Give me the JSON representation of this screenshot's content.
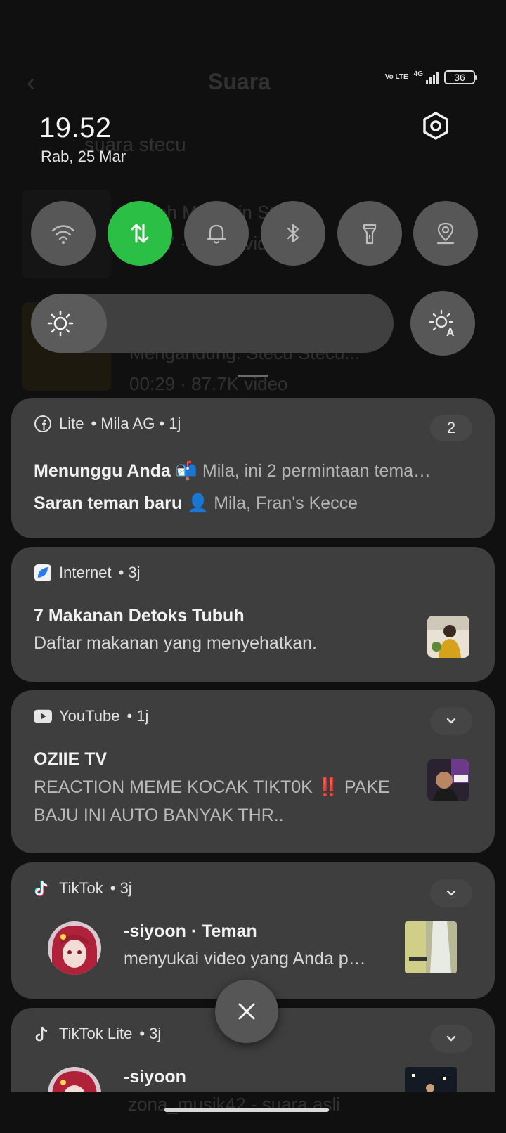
{
  "background_app": {
    "title": "Suara",
    "search": "suara stecu",
    "row1_line1": "Ikweh Meringin Stecu",
    "row1_line2": "00:17 · 14.2K video",
    "row2_line1": "Mengandung: Stecu Stecu...",
    "row2_line2": "00:29 · 87.7K video",
    "bottom_text": "zona_musik42 - suara asli"
  },
  "status_bar": {
    "volte": "Vo LTE",
    "network": "4G",
    "battery": "36"
  },
  "header": {
    "time": "19.52",
    "date": "Rab, 25 Mar"
  },
  "quick_settings": {
    "tiles": [
      {
        "name": "wifi",
        "icon": "wifi-icon",
        "active": false
      },
      {
        "name": "mobile-data",
        "icon": "data-arrows-icon",
        "active": true
      },
      {
        "name": "sound",
        "icon": "bell-icon",
        "active": false
      },
      {
        "name": "bluetooth",
        "icon": "bluetooth-icon",
        "active": false
      },
      {
        "name": "flashlight",
        "icon": "flashlight-icon",
        "active": false
      },
      {
        "name": "location",
        "icon": "location-pin-icon",
        "active": false
      }
    ],
    "brightness_level": 0.21,
    "colors": {
      "active_tile": "#2cbf46",
      "inactive_tile": "#565756"
    }
  },
  "notifications": [
    {
      "app": "Lite",
      "meta": "• Mila AG • 1j",
      "count": "2",
      "lines": [
        {
          "bold": "Menunggu Anda",
          "emoji": "📬",
          "text": "Mila, ini 2 permintaan tema…"
        },
        {
          "bold": "Saran teman baru",
          "emoji": "👤",
          "text": "Mila, Fran's Kecce"
        }
      ]
    },
    {
      "app": "Internet",
      "meta": "• 3j",
      "title": "7 Makanan Detoks Tubuh",
      "body": "Daftar makanan yang menyehatkan."
    },
    {
      "app": "YouTube",
      "meta": "• 1j",
      "title": "OZIIE TV",
      "body_line1": "REACTION MEME KOCAK TIKT0K ‼️ PAKE",
      "body_line2": "BAJU INI AUTO BANYAK THR.."
    },
    {
      "app": "TikTok",
      "meta": "• 3j",
      "title": "-siyoon · Teman",
      "body": "menyukai video yang Anda p…"
    },
    {
      "app": "TikTok Lite",
      "meta": "• 3j",
      "title": "-siyoon"
    }
  ]
}
